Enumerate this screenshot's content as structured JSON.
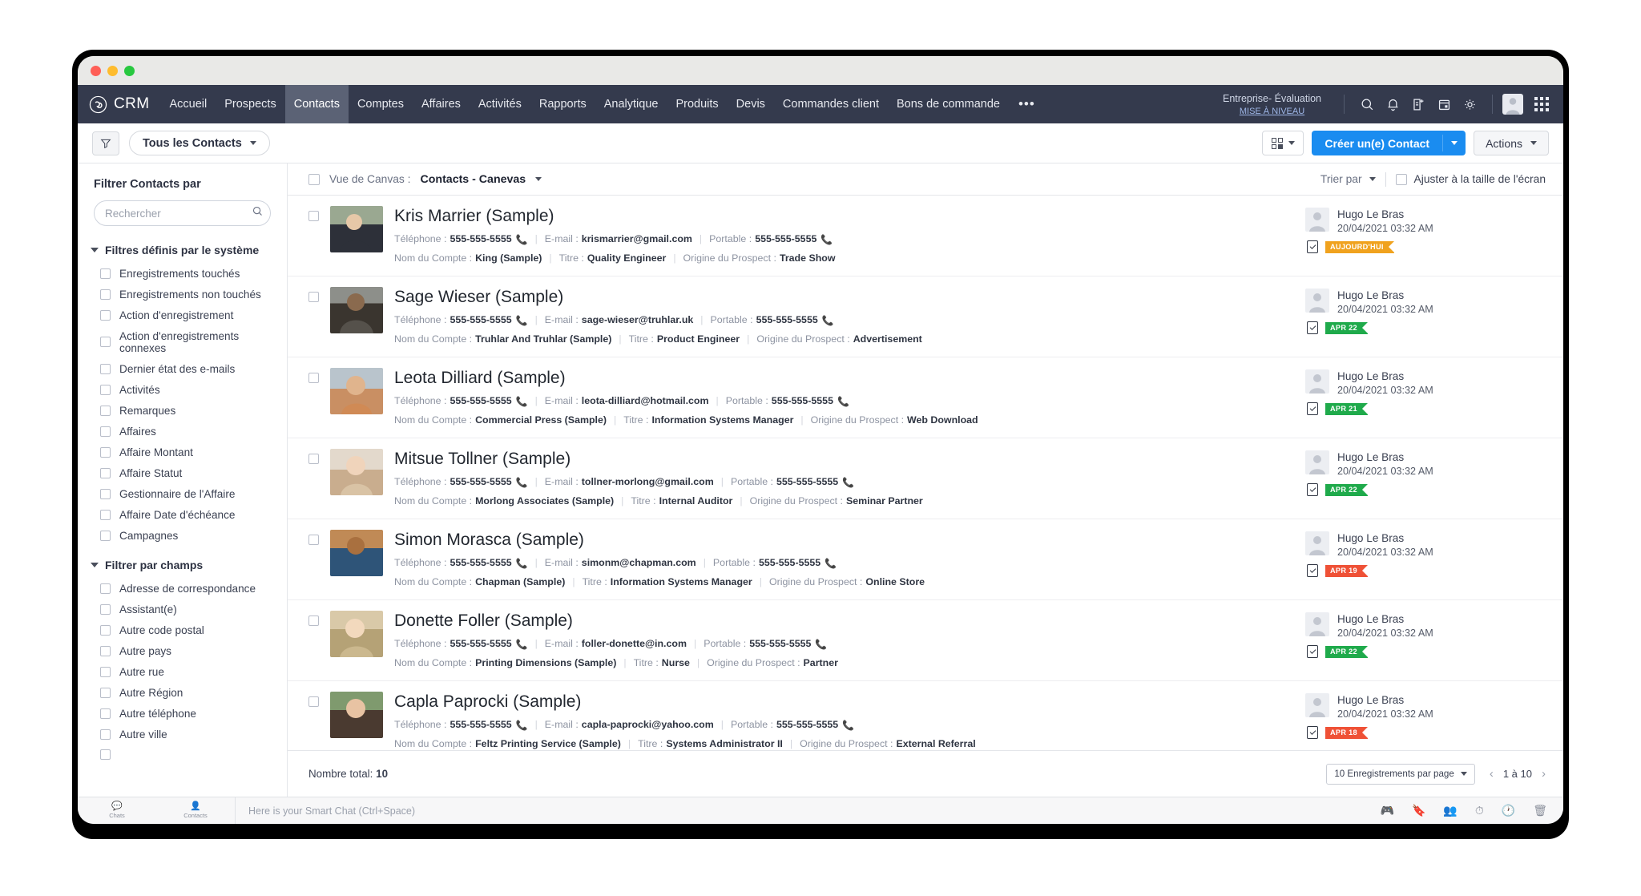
{
  "window": {
    "traffic_lights": [
      "close",
      "minimize",
      "maximize"
    ]
  },
  "nav": {
    "brand": "CRM",
    "items": [
      {
        "label": "Accueil",
        "active": false
      },
      {
        "label": "Prospects",
        "active": false
      },
      {
        "label": "Contacts",
        "active": true
      },
      {
        "label": "Comptes",
        "active": false
      },
      {
        "label": "Affaires",
        "active": false
      },
      {
        "label": "Activités",
        "active": false
      },
      {
        "label": "Rapports",
        "active": false
      },
      {
        "label": "Analytique",
        "active": false
      },
      {
        "label": "Produits",
        "active": false
      },
      {
        "label": "Devis",
        "active": false
      },
      {
        "label": "Commandes client",
        "active": false
      },
      {
        "label": "Bons de commande",
        "active": false
      }
    ],
    "more_label": "•••",
    "enterprise": {
      "title": "Entreprise- Évaluation",
      "upgrade": "MISE À NIVEAU"
    },
    "icons": [
      "search-icon",
      "bell-icon",
      "note-add-icon",
      "calendar-icon",
      "gear-icon",
      "avatar",
      "apps-grid-icon"
    ]
  },
  "toolbar": {
    "filter_icon": "funnel-icon",
    "view_label": "Tous les Contacts",
    "kanban_icon": "kanban-view-icon",
    "create_label": "Créer un(e) Contact",
    "actions_label": "Actions"
  },
  "sidebar": {
    "title": "Filtrer Contacts par",
    "search_placeholder": "Rechercher",
    "groups": [
      {
        "label": "Filtres définis par le système",
        "items": [
          "Enregistrements touchés",
          "Enregistrements non touchés",
          "Action d'enregistrement",
          "Action d'enregistrements connexes",
          "Dernier état des e-mails",
          "Activités",
          "Remarques",
          "Affaires",
          "Affaire Montant",
          "Affaire Statut",
          "Gestionnaire de l'Affaire",
          "Affaire Date d'échéance",
          "Campagnes"
        ]
      },
      {
        "label": "Filtrer par champs",
        "items": [
          "Adresse de correspondance",
          "Assistant(e)",
          "Autre code postal",
          "Autre pays",
          "Autre rue",
          "Autre Région",
          "Autre téléphone",
          "Autre ville"
        ]
      }
    ]
  },
  "list_header": {
    "canvas_label": "Vue de Canvas :",
    "canvas_value": "Contacts - Canevas",
    "sort_label": "Trier par",
    "fit_label": "Ajuster à la taille de l'écran"
  },
  "labels": {
    "phone": "Téléphone :",
    "email": "E-mail :",
    "mobile": "Portable :",
    "account": "Nom du Compte :",
    "title": "Titre :",
    "source": "Origine du Prospect :"
  },
  "records": [
    {
      "name": "Kris Marrier (Sample)",
      "phone": "555-555-5555",
      "email": "krismarrier@gmail.com",
      "mobile": "555-555-5555",
      "account": "King (Sample)",
      "title": "Quality Engineer",
      "source": "Trade Show",
      "owner": "Hugo Le Bras",
      "date": "20/04/2021 03:32 AM",
      "flag": "AUJOURD'HUI",
      "flag_color": "#f0a21e",
      "photo_top": "#9aa891",
      "photo_bottom": "#2d3039"
    },
    {
      "name": "Sage Wieser (Sample)",
      "phone": "555-555-5555",
      "email": "sage-wieser@truhlar.uk",
      "mobile": "555-555-5555",
      "account": "Truhlar And Truhlar (Sample)",
      "title": "Product Engineer",
      "source": "Advertisement",
      "owner": "Hugo Le Bras",
      "date": "20/04/2021 03:32 AM",
      "flag": "APR 22",
      "flag_color": "#1faa4b",
      "photo_top": "#8d8f8a",
      "photo_bottom": "#3a352f"
    },
    {
      "name": "Leota Dilliard (Sample)",
      "phone": "555-555-5555",
      "email": "leota-dilliard@hotmail.com",
      "mobile": "555-555-5555",
      "account": "Commercial Press (Sample)",
      "title": "Information Systems Manager",
      "source": "Web Download",
      "owner": "Hugo Le Bras",
      "date": "20/04/2021 03:32 AM",
      "flag": "APR 21",
      "flag_color": "#1faa4b",
      "photo_top": "#b9c4cc",
      "photo_bottom": "#c98f63"
    },
    {
      "name": "Mitsue Tollner (Sample)",
      "phone": "555-555-5555",
      "email": "tollner-morlong@gmail.com",
      "mobile": "555-555-5555",
      "account": "Morlong Associates (Sample)",
      "title": "Internal Auditor",
      "source": "Seminar Partner",
      "owner": "Hugo Le Bras",
      "date": "20/04/2021 03:32 AM",
      "flag": "APR 22",
      "flag_color": "#1faa4b",
      "photo_top": "#e3d9cc",
      "photo_bottom": "#c9ad8e"
    },
    {
      "name": "Simon Morasca (Sample)",
      "phone": "555-555-5555",
      "email": "simonm@chapman.com",
      "mobile": "555-555-5555",
      "account": "Chapman (Sample)",
      "title": "Information Systems Manager",
      "source": "Online Store",
      "owner": "Hugo Le Bras",
      "date": "20/04/2021 03:32 AM",
      "flag": "APR 19",
      "flag_color": "#ef5136",
      "photo_top": "#c08a56",
      "photo_bottom": "#2e5478"
    },
    {
      "name": "Donette Foller (Sample)",
      "phone": "555-555-5555",
      "email": "foller-donette@in.com",
      "mobile": "555-555-5555",
      "account": "Printing Dimensions (Sample)",
      "title": "Nurse",
      "source": "Partner",
      "owner": "Hugo Le Bras",
      "date": "20/04/2021 03:32 AM",
      "flag": "APR 22",
      "flag_color": "#1faa4b",
      "photo_top": "#d9c9a8",
      "photo_bottom": "#b5a276"
    },
    {
      "name": "Capla Paprocki (Sample)",
      "phone": "555-555-5555",
      "email": "capla-paprocki@yahoo.com",
      "mobile": "555-555-5555",
      "account": "Feltz Printing Service (Sample)",
      "title": "Systems Administrator II",
      "source": "External Referral",
      "owner": "Hugo Le Bras",
      "date": "20/04/2021 03:32 AM",
      "flag": "APR 18",
      "flag_color": "#ef5136",
      "photo_top": "#7f9a6e",
      "photo_bottom": "#4a3a30"
    }
  ],
  "footer": {
    "total_label": "Nombre total:",
    "total_value": "10",
    "per_page": "10 Enregistrements par page",
    "range": "1 à 10"
  },
  "statusbar": {
    "tabs": [
      {
        "label": "Chats",
        "icon": "chat-icon"
      },
      {
        "label": "Contacts",
        "icon": "contact-icon"
      }
    ],
    "chat_placeholder": "Here is your Smart Chat (Ctrl+Space)",
    "right_icons": [
      "game-icon",
      "bookmark-icon",
      "group-icon",
      "clock-icon",
      "history-icon",
      "trash-icon"
    ]
  }
}
